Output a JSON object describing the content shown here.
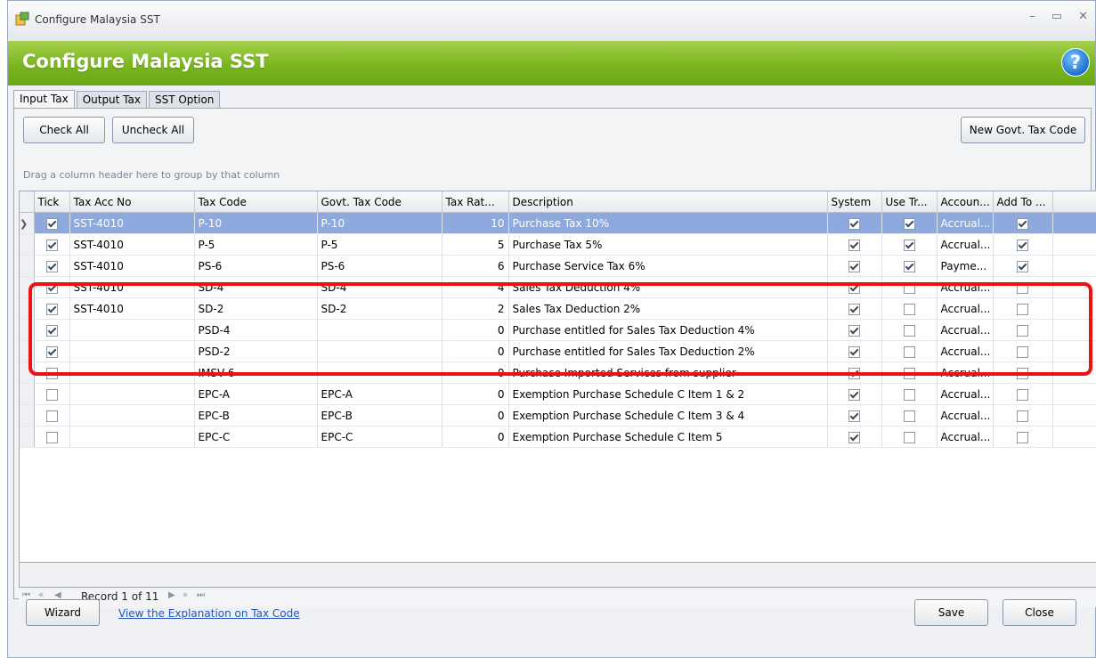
{
  "window": {
    "title": "Configure Malaysia SST",
    "controls": [
      "–",
      "▭",
      "✕"
    ]
  },
  "banner": {
    "title": "Configure Malaysia SST",
    "help_icon": "?"
  },
  "tabs": [
    {
      "label": "Input Tax",
      "active": true
    },
    {
      "label": "Output Tax",
      "active": false
    },
    {
      "label": "SST Option",
      "active": false
    }
  ],
  "toolbar": {
    "check_all": "Check All",
    "uncheck_all": "Uncheck All",
    "new_govt_tax_code": "New Govt. Tax Code"
  },
  "grid": {
    "group_hint": "Drag a column header here to group by that column",
    "columns": [
      "Tick",
      "Tax Acc No",
      "Tax Code",
      "Govt. Tax Code",
      "Tax Rat...",
      "Description",
      "System",
      "Use Tr...",
      "Accoun...",
      "Add To ..."
    ],
    "rows": [
      {
        "tick": true,
        "tax_acc_no": "SST-4010",
        "tax_code": "P-10",
        "govt_tax_code": "P-10",
        "rate": "10",
        "description": "Purchase Tax 10%",
        "system": true,
        "use_tr": true,
        "account": "Accrual...",
        "add_to": true,
        "selected": true
      },
      {
        "tick": true,
        "tax_acc_no": "SST-4010",
        "tax_code": "P-5",
        "govt_tax_code": "P-5",
        "rate": "5",
        "description": "Purchase Tax 5%",
        "system": true,
        "use_tr": true,
        "account": "Accrual...",
        "add_to": true
      },
      {
        "tick": true,
        "tax_acc_no": "SST-4010",
        "tax_code": "PS-6",
        "govt_tax_code": "PS-6",
        "rate": "6",
        "description": "Purchase Service Tax 6%",
        "system": true,
        "use_tr": true,
        "account": "Payme...",
        "add_to": true
      },
      {
        "tick": true,
        "tax_acc_no": "SST-4010",
        "tax_code": "SD-4",
        "govt_tax_code": "SD-4",
        "rate": "4",
        "description": "Sales Tax Deduction 4%",
        "system": true,
        "use_tr": false,
        "account": "Accrual...",
        "add_to": false
      },
      {
        "tick": true,
        "tax_acc_no": "SST-4010",
        "tax_code": "SD-2",
        "govt_tax_code": "SD-2",
        "rate": "2",
        "description": "Sales Tax Deduction 2%",
        "system": true,
        "use_tr": false,
        "account": "Accrual...",
        "add_to": false
      },
      {
        "tick": true,
        "tax_acc_no": "",
        "tax_code": "PSD-4",
        "govt_tax_code": "",
        "rate": "0",
        "description": "Purchase entitled for Sales Tax Deduction 4%",
        "system": true,
        "use_tr": false,
        "account": "Accrual...",
        "add_to": false
      },
      {
        "tick": true,
        "tax_acc_no": "",
        "tax_code": "PSD-2",
        "govt_tax_code": "",
        "rate": "0",
        "description": "Purchase entitled for Sales Tax Deduction 2%",
        "system": true,
        "use_tr": false,
        "account": "Accrual...",
        "add_to": false
      },
      {
        "tick": false,
        "tax_acc_no": "",
        "tax_code": "IMSV-6",
        "govt_tax_code": "",
        "rate": "0",
        "description": "Purchase Imported Services from supplier",
        "system": true,
        "use_tr": false,
        "account": "Accrual...",
        "add_to": false
      },
      {
        "tick": false,
        "tax_acc_no": "",
        "tax_code": "EPC-A",
        "govt_tax_code": "EPC-A",
        "rate": "0",
        "description": "Exemption Purchase Schedule C Item 1 & 2",
        "system": true,
        "use_tr": false,
        "account": "Accrual...",
        "add_to": false
      },
      {
        "tick": false,
        "tax_acc_no": "",
        "tax_code": "EPC-B",
        "govt_tax_code": "EPC-B",
        "rate": "0",
        "description": "Exemption Purchase Schedule C Item 3 & 4",
        "system": true,
        "use_tr": false,
        "account": "Accrual...",
        "add_to": false
      },
      {
        "tick": false,
        "tax_acc_no": "",
        "tax_code": "EPC-C",
        "govt_tax_code": "EPC-C",
        "rate": "0",
        "description": "Exemption Purchase Schedule C Item 5",
        "system": true,
        "use_tr": false,
        "account": "Accrual...",
        "add_to": false
      }
    ]
  },
  "navigator": {
    "record_text": "Record 1 of 11",
    "first": "⏮",
    "prev_page": "«",
    "prev": "◀",
    "next": "▶",
    "next_page": "»",
    "last": "⏭"
  },
  "footer": {
    "wizard": "Wizard",
    "explanation_link": "View the Explanation on Tax Code",
    "save": "Save",
    "close": "Close"
  },
  "colors": {
    "banner_green": "#7ab51f",
    "selection_blue": "#8ea9de",
    "highlight_red": "#ee1111",
    "link_blue": "#2255bb"
  }
}
